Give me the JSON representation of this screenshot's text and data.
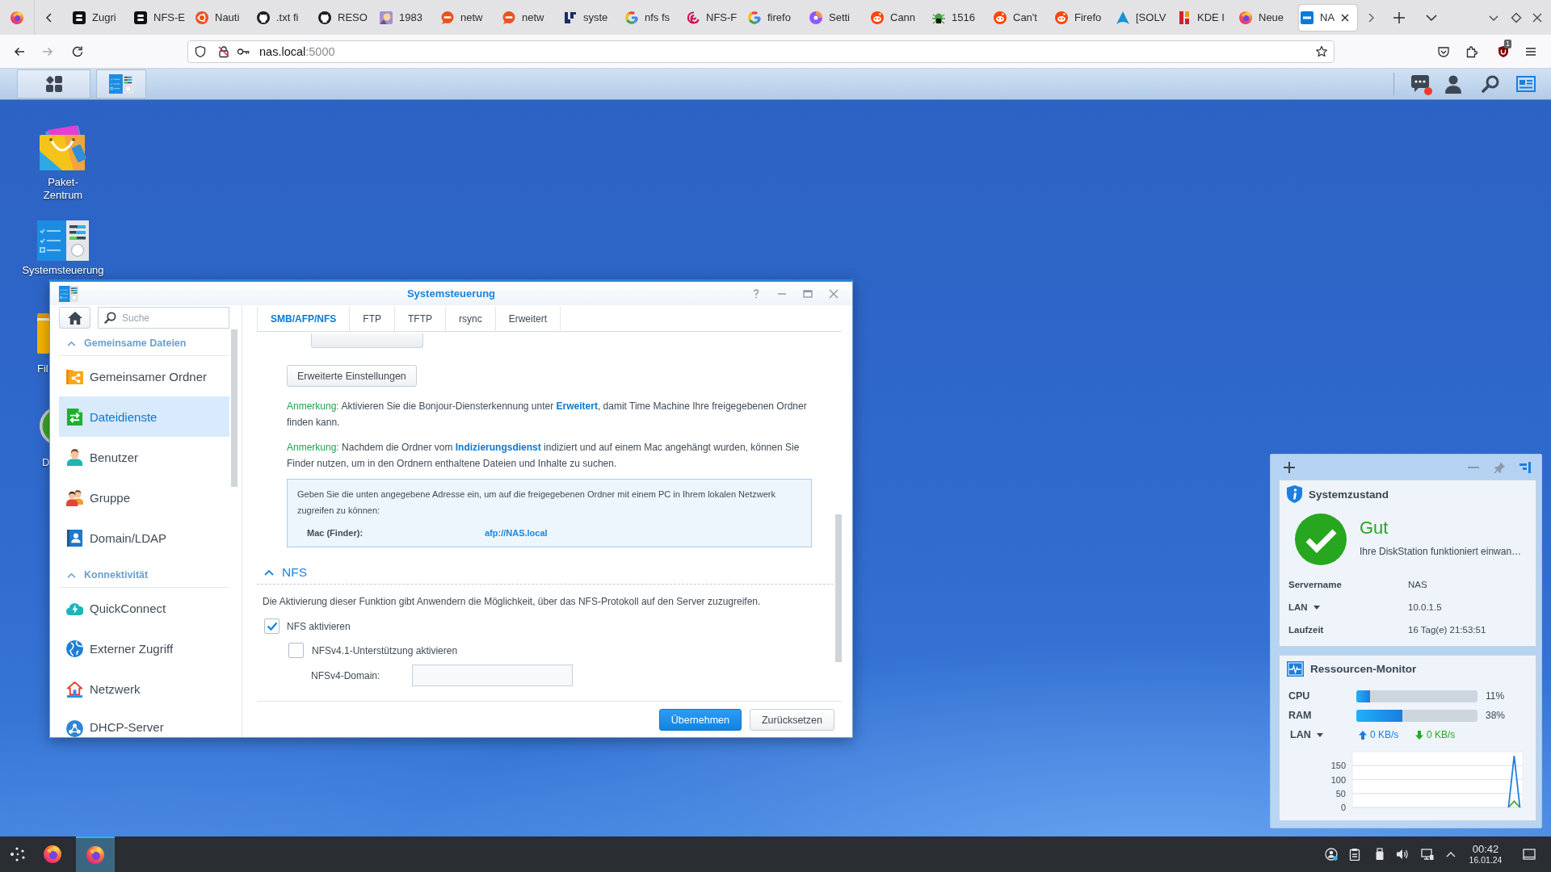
{
  "browser": {
    "tabs": [
      {
        "title": "Zugri",
        "kind": "tile",
        "selected": false
      },
      {
        "title": "NFS-E",
        "kind": "tile",
        "selected": false
      },
      {
        "title": "Nauti",
        "kind": "ring",
        "selected": false
      },
      {
        "title": ".txt fi",
        "kind": "cat",
        "selected": false
      },
      {
        "title": "RESO",
        "kind": "cat",
        "selected": false
      },
      {
        "title": "1983",
        "kind": "picture",
        "selected": false
      },
      {
        "title": "netw",
        "kind": "bubble",
        "selected": false
      },
      {
        "title": "netw",
        "kind": "bubble",
        "selected": false
      },
      {
        "title": "syste",
        "kind": "emblem",
        "selected": false
      },
      {
        "title": "nfs fs",
        "kind": "segments",
        "selected": false
      },
      {
        "title": "NFS-F",
        "kind": "swirl",
        "selected": false
      },
      {
        "title": "firefo",
        "kind": "segments",
        "selected": false
      },
      {
        "title": "Setti",
        "kind": "globe",
        "selected": false
      },
      {
        "title": "Cann",
        "kind": "alien",
        "selected": false
      },
      {
        "title": "1516",
        "kind": "bug",
        "selected": false
      },
      {
        "title": "Can't",
        "kind": "alien",
        "selected": false
      },
      {
        "title": "Firefo",
        "kind": "alien",
        "selected": false
      },
      {
        "title": "[SOLV",
        "kind": "peak",
        "selected": false
      },
      {
        "title": "KDE I",
        "kind": "bars",
        "selected": false
      },
      {
        "title": "Neue",
        "kind": "fox",
        "selected": false
      },
      {
        "title": "NA",
        "kind": "app-tile",
        "selected": true
      }
    ],
    "forward_disabled": true,
    "address": {
      "host": "nas.local",
      "port": ":5000"
    },
    "extension_badge": "1"
  },
  "dsm_bar": {
    "notification": true
  },
  "desktop_icons": [
    {
      "label": "Paket-Zentrum",
      "kind": "package"
    },
    {
      "label": "Systemsteuerung",
      "kind": "control-panel"
    },
    {
      "label": "Fil",
      "kind": "folder"
    },
    {
      "label": "D",
      "kind": "disc"
    }
  ],
  "window": {
    "title": "Systemsteuerung",
    "search": {
      "placeholder": "Suche"
    },
    "sidebar": [
      {
        "section": "Gemeinsame Dateien",
        "expanded": true,
        "items": [
          {
            "label": "Gemeinsamer Ordner",
            "kind": "shared-folder",
            "selected": false
          },
          {
            "label": "Dateidienste",
            "kind": "file-services",
            "selected": true
          },
          {
            "label": "Benutzer",
            "kind": "user",
            "selected": false
          },
          {
            "label": "Gruppe",
            "kind": "group",
            "selected": false
          },
          {
            "label": "Domain/LDAP",
            "kind": "directory",
            "selected": false
          }
        ]
      },
      {
        "section": "Konnektivität",
        "expanded": true,
        "items": [
          {
            "label": "QuickConnect",
            "kind": "quickconnect",
            "selected": false
          },
          {
            "label": "Externer Zugriff",
            "kind": "external-access",
            "selected": false
          },
          {
            "label": "Netzwerk",
            "kind": "network",
            "selected": false
          },
          {
            "label": "DHCP-Server",
            "kind": "dhcp",
            "selected": false
          }
        ]
      }
    ],
    "tabs": [
      {
        "label": "SMB/AFP/NFS",
        "selected": true
      },
      {
        "label": "FTP",
        "selected": false
      },
      {
        "label": "TFTP",
        "selected": false
      },
      {
        "label": "rsync",
        "selected": false
      },
      {
        "label": "Erweitert",
        "selected": false
      }
    ],
    "content": {
      "advanced_button": "Erweiterte Einstellungen",
      "notes": [
        {
          "label": "Anmerkung:",
          "before": "Aktivieren Sie die Bonjour-Diensterkennung unter ",
          "link": "Erweitert",
          "after": ", damit Time Machine Ihre freigegebenen Ordner finden kann."
        },
        {
          "label": "Anmerkung:",
          "before": "Nachdem die Ordner vom ",
          "link": "Indizierungsdienst",
          "after": " indiziert und auf einem Mac angehängt wurden, können Sie Finder nutzen, um in den Ordnern enthaltene Dateien und Inhalte zu suchen."
        }
      ],
      "info_box": {
        "text": "Geben Sie die unten angegebene Adresse ein, um auf die freigegebenen Ordner mit einem PC in Ihrem lokalen Netzwerk zugreifen zu können:",
        "key": "Mac (Finder):",
        "value": "afp://NAS.local"
      },
      "nfs": {
        "title": "NFS",
        "expanded": true,
        "description": "Die Aktivierung dieser Funktion gibt Anwendern die Möglichkeit, über das NFS-Protokoll auf den Server zuzugreifen.",
        "options": [
          {
            "kind": "checkbox",
            "label": "NFS aktivieren",
            "checked": true,
            "children": [
              {
                "kind": "checkbox",
                "label": "NFSv4.1-Unterstützung aktivieren",
                "checked": false
              },
              {
                "kind": "field",
                "label": "NFSv4-Domain:"
              }
            ]
          }
        ]
      }
    },
    "buttons": [
      {
        "label": "Übernehmen",
        "kind": "primary"
      },
      {
        "label": "Zurücksetzen",
        "kind": "default"
      }
    ]
  },
  "widgets": {
    "system_health": {
      "title": "Systemzustand",
      "status": "Gut",
      "message": "Ihre DiskStation funktioniert einwan…",
      "rows": [
        {
          "label": "Servername",
          "value": "NAS",
          "dropdown": false
        },
        {
          "label": "LAN",
          "value": "10.0.1.5",
          "dropdown": true
        },
        {
          "label": "Laufzeit",
          "value": "16 Tag(e) 21:53:51",
          "dropdown": false
        }
      ]
    },
    "resource_monitor": {
      "title": "Ressourcen-Monitor",
      "meters": [
        {
          "label": "CPU",
          "level": 0.11,
          "reading": "11%"
        },
        {
          "label": "RAM",
          "level": 0.38,
          "reading": "38%"
        }
      ],
      "network": {
        "label": "LAN",
        "dropdown": true,
        "upload": "0 KB/s",
        "download": "0 KB/s"
      },
      "chart_data": {
        "type": "line",
        "series": [
          {
            "color": "#1f7fe0",
            "values": [
              null,
              null,
              null,
              null,
              null,
              null,
              null,
              null,
              null,
              null,
              null,
              null,
              null,
              null,
              null,
              null,
              null,
              null,
              null,
              null,
              null,
              null,
              null,
              null,
              null,
              null,
              null,
              0,
              185,
              0
            ]
          },
          {
            "color": "#3bab3b",
            "values": [
              null,
              null,
              null,
              null,
              null,
              null,
              null,
              null,
              null,
              null,
              null,
              null,
              null,
              null,
              null,
              null,
              null,
              null,
              null,
              null,
              null,
              null,
              null,
              null,
              null,
              null,
              null,
              0,
              22,
              0
            ]
          }
        ],
        "ylim": [
          0,
          200
        ],
        "yticks": [
          0,
          50,
          100,
          150
        ],
        "grid": true
      }
    }
  },
  "taskbar": {
    "tasks": [
      {
        "kind": "browser",
        "selected": false
      },
      {
        "kind": "browser",
        "selected": true
      }
    ],
    "clock": {
      "time": "00:42",
      "date": "16.01.24"
    }
  }
}
